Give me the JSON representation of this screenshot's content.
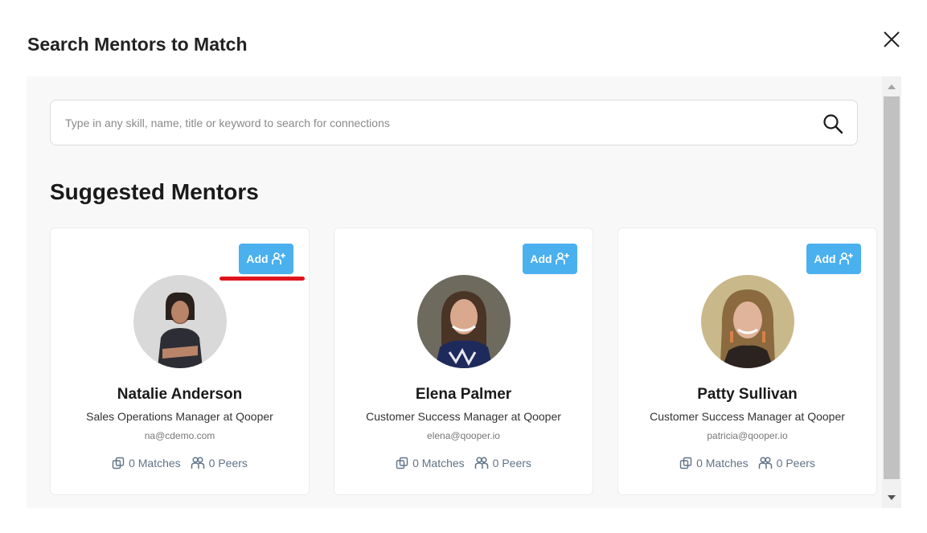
{
  "modal": {
    "title": "Search Mentors to Match"
  },
  "search": {
    "placeholder": "Type in any skill, name, title or keyword to search for connections",
    "value": ""
  },
  "section": {
    "title": "Suggested Mentors"
  },
  "mentors": [
    {
      "name": "Natalie Anderson",
      "role": "Sales Operations Manager at Qooper",
      "email": "na@cdemo.com",
      "matches": "0 Matches",
      "peers": "0 Peers",
      "add_label": "Add",
      "avatar_color": "#9aa0a8"
    },
    {
      "name": "Elena Palmer",
      "role": "Customer Success Manager at Qooper",
      "email": "elena@qooper.io",
      "matches": "0 Matches",
      "peers": "0 Peers",
      "add_label": "Add",
      "avatar_color": "#7a6a5c"
    },
    {
      "name": "Patty Sullivan",
      "role": "Customer Success Manager at Qooper",
      "email": "patricia@qooper.io",
      "matches": "0 Matches",
      "peers": "0 Peers",
      "add_label": "Add",
      "avatar_color": "#8b7a4e"
    }
  ],
  "colors": {
    "accent": "#4ab0ee",
    "highlight": "#e0141c",
    "stat_text": "#5f7387"
  },
  "icons": {
    "close": "close-icon",
    "search": "search-icon",
    "add_user": "add-user-icon",
    "matches": "matches-icon",
    "peers": "peers-icon"
  }
}
